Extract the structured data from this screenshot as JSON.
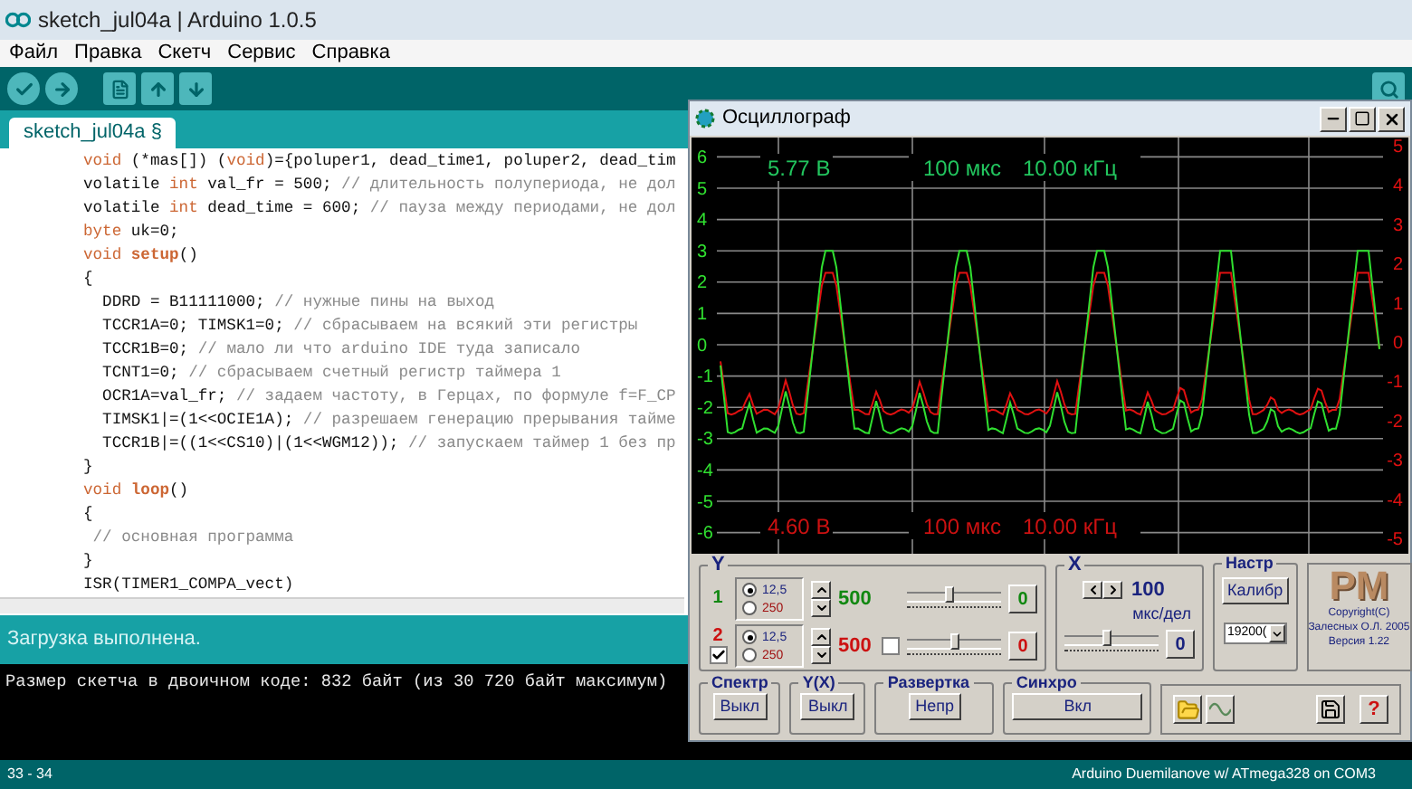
{
  "window": {
    "title": "sketch_jul04a | Arduino 1.0.5"
  },
  "menu": [
    "Файл",
    "Правка",
    "Скетч",
    "Сервис",
    "Справка"
  ],
  "tabs": [
    {
      "label": "sketch_jul04a §",
      "selected": true
    }
  ],
  "editor": {
    "lines": [
      {
        "segments": [
          {
            "kind": "keyword",
            "text": "void"
          },
          {
            "kind": "plain",
            "text": " (*mas[]) ("
          },
          {
            "kind": "keyword",
            "text": "void"
          },
          {
            "kind": "plain",
            "text": ")={poluper1, dead_time1, poluper2, dead_tim"
          }
        ]
      },
      {
        "segments": [
          {
            "kind": "plain",
            "text": "volatile "
          },
          {
            "kind": "keyword",
            "text": "int"
          },
          {
            "kind": "plain",
            "text": " val_fr = 500; "
          },
          {
            "kind": "comment",
            "text": "// длительность полупериода, не дол"
          }
        ]
      },
      {
        "segments": [
          {
            "kind": "plain",
            "text": "volatile "
          },
          {
            "kind": "keyword",
            "text": "int"
          },
          {
            "kind": "plain",
            "text": " dead_time = 600; "
          },
          {
            "kind": "comment",
            "text": "// пауза между периодами, не дол"
          }
        ]
      },
      {
        "segments": [
          {
            "kind": "keyword",
            "text": "byte"
          },
          {
            "kind": "plain",
            "text": " uk=0;"
          }
        ]
      },
      {
        "segments": [
          {
            "kind": "keyword",
            "text": "void "
          },
          {
            "kind": "function",
            "text": "setup"
          },
          {
            "kind": "plain",
            "text": "()"
          }
        ]
      },
      {
        "segments": [
          {
            "kind": "plain",
            "text": "{"
          }
        ]
      },
      {
        "segments": [
          {
            "kind": "plain",
            "text": "  DDRD = B11111000; "
          },
          {
            "kind": "comment",
            "text": "// нужные пины на выход"
          }
        ]
      },
      {
        "segments": [
          {
            "kind": "plain",
            "text": "  TCCR1A=0; TIMSK1=0; "
          },
          {
            "kind": "comment",
            "text": "// сбрасываем на всякий эти регистры"
          }
        ]
      },
      {
        "segments": [
          {
            "kind": "plain",
            "text": "  TCCR1B=0; "
          },
          {
            "kind": "comment",
            "text": "// мало ли что arduino IDE туда записало"
          }
        ]
      },
      {
        "segments": [
          {
            "kind": "plain",
            "text": "  TCNT1=0; "
          },
          {
            "kind": "comment",
            "text": "// сбрасываем счетный регистр таймера 1"
          }
        ]
      },
      {
        "segments": [
          {
            "kind": "plain",
            "text": "  OCR1A=val_fr; "
          },
          {
            "kind": "comment",
            "text": "// задаем частоту, в Герцах, по формуле f=F_CP"
          }
        ]
      },
      {
        "segments": [
          {
            "kind": "plain",
            "text": "  TIMSK1|=(1<<OCIE1A); "
          },
          {
            "kind": "comment",
            "text": "// разрешаем генерацию прерывания тайме"
          }
        ]
      },
      {
        "segments": [
          {
            "kind": "plain",
            "text": "  TCCR1B|=((1<<CS10)|(1<<WGM12)); "
          },
          {
            "kind": "comment",
            "text": "// запускаем таймер 1 без пр"
          }
        ]
      },
      {
        "segments": [
          {
            "kind": "plain",
            "text": "}"
          }
        ]
      },
      {
        "segments": [
          {
            "kind": "keyword",
            "text": "void "
          },
          {
            "kind": "function",
            "text": "loop"
          },
          {
            "kind": "plain",
            "text": "()"
          }
        ]
      },
      {
        "segments": [
          {
            "kind": "plain",
            "text": "{"
          }
        ]
      },
      {
        "segments": [
          {
            "kind": "comment",
            "text": " // основная программа"
          }
        ]
      },
      {
        "segments": [
          {
            "kind": "plain",
            "text": "}"
          }
        ]
      },
      {
        "segments": [
          {
            "kind": "plain",
            "text": "ISR(TIMER1_COMPA_vect)"
          }
        ]
      }
    ]
  },
  "message": "Загрузка выполнена.",
  "console": [
    "Размер скетча в двоичном коде: 832 байт (из 30 720 байт максимум)"
  ],
  "status_bar": {
    "line": "33 - 34",
    "board": "Arduino Duemilanove w/ ATmega328 on COM3"
  },
  "scope": {
    "title": "Осциллограф",
    "left_ticks": [
      "6",
      "5",
      "4",
      "3",
      "2",
      "1",
      "0",
      "-1",
      "-2",
      "-3",
      "-4",
      "-5",
      "-6"
    ],
    "right_ticks": [
      "5",
      "4",
      "3",
      "2",
      "1",
      "0",
      "-1",
      "-2",
      "-3",
      "-4",
      "-5"
    ],
    "readouts": [
      {
        "color": "#22c55e",
        "voltage": "5.77 В",
        "time": "100 мкс",
        "frequency": "10.00 кГц"
      },
      {
        "color": "#cc1111",
        "voltage": "4.60 В",
        "time": "100 мкс",
        "frequency": "10.00 кГц"
      }
    ],
    "y_group": {
      "label": "Y",
      "channels": [
        {
          "label": "1",
          "color": "#118811",
          "scales": [
            {
              "label": "12,5",
              "selected": true
            },
            {
              "label": "250",
              "selected": false
            }
          ],
          "gain": "500",
          "level": 0.45,
          "zero": "0"
        },
        {
          "label": "2",
          "color": "#cc1111",
          "shown": true,
          "inverted": false,
          "scales": [
            {
              "label": "12,5",
              "selected": true
            },
            {
              "label": "250",
              "selected": false
            }
          ],
          "gain": "500",
          "level": 0.5,
          "zero": "0"
        }
      ]
    },
    "x_group": {
      "label": "X",
      "value": "100",
      "unit": "мкс/дел",
      "level": 0.45,
      "zero": "0"
    },
    "settings": {
      "label": "Настр",
      "button": "Калибр",
      "baud": "19200("
    },
    "logo": {
      "mark": "PM",
      "lines": [
        "Copyright(C)",
        "Залесных О.Л. 2005",
        "Версия 1.22"
      ]
    },
    "modes": [
      {
        "label": "Спектр",
        "button": "Выкл"
      },
      {
        "label": "Y(X)",
        "button": "Выкл"
      },
      {
        "label": "Развертка",
        "button": "Непр"
      },
      {
        "label": "Синхро",
        "button": "Вкл"
      }
    ],
    "tools": [
      {
        "kind": "open"
      },
      {
        "kind": "wave"
      },
      {
        "kind": "save"
      },
      {
        "kind": "help",
        "text": "?"
      }
    ]
  }
}
